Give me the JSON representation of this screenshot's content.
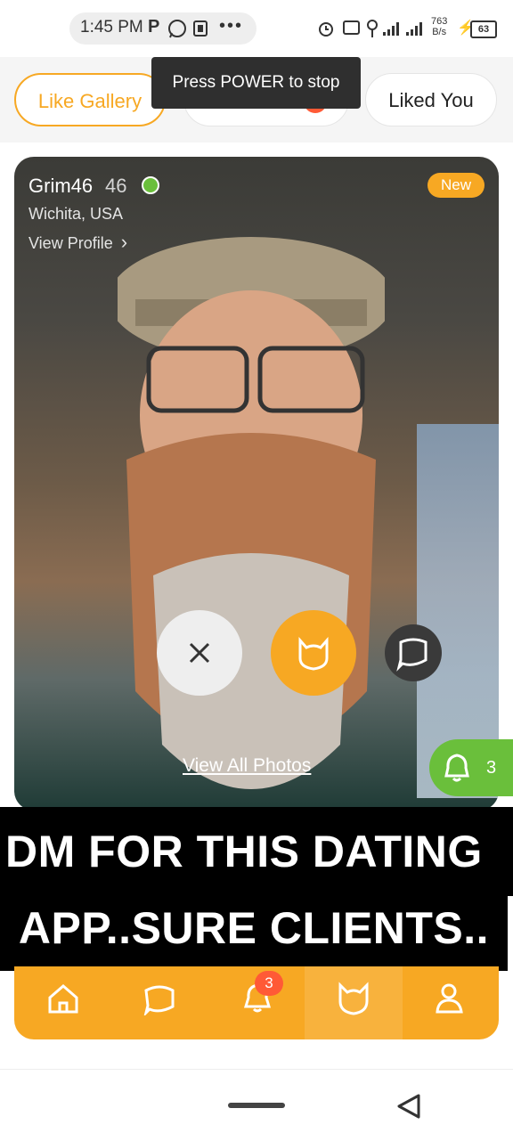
{
  "status_bar": {
    "time": "1:45 PM",
    "network_speed_value": "763",
    "network_speed_unit": "B/s",
    "battery": "63"
  },
  "tabs": {
    "like_gallery": "Like Gallery",
    "liked_you": "Liked You"
  },
  "toast": "Press POWER to stop",
  "profile": {
    "username": "Grim46",
    "age": "46",
    "location": "Wichita, USA",
    "view_profile": "View Profile",
    "badge": "New",
    "view_all_photos": "View All Photos"
  },
  "notifications": {
    "count": "3"
  },
  "caption": {
    "line1": "DM FOR THIS DATING",
    "line2": "APP..SURE CLIENTS.."
  },
  "bottom_nav": {
    "items": [
      "home-icon",
      "chat-icon",
      "bell-icon",
      "cat-icon",
      "profile-icon"
    ],
    "bell_badge": "3",
    "active": "cat-icon"
  },
  "colors": {
    "accent": "#f7a823",
    "online": "#6abf3b",
    "badge_red": "#ff5a36"
  }
}
